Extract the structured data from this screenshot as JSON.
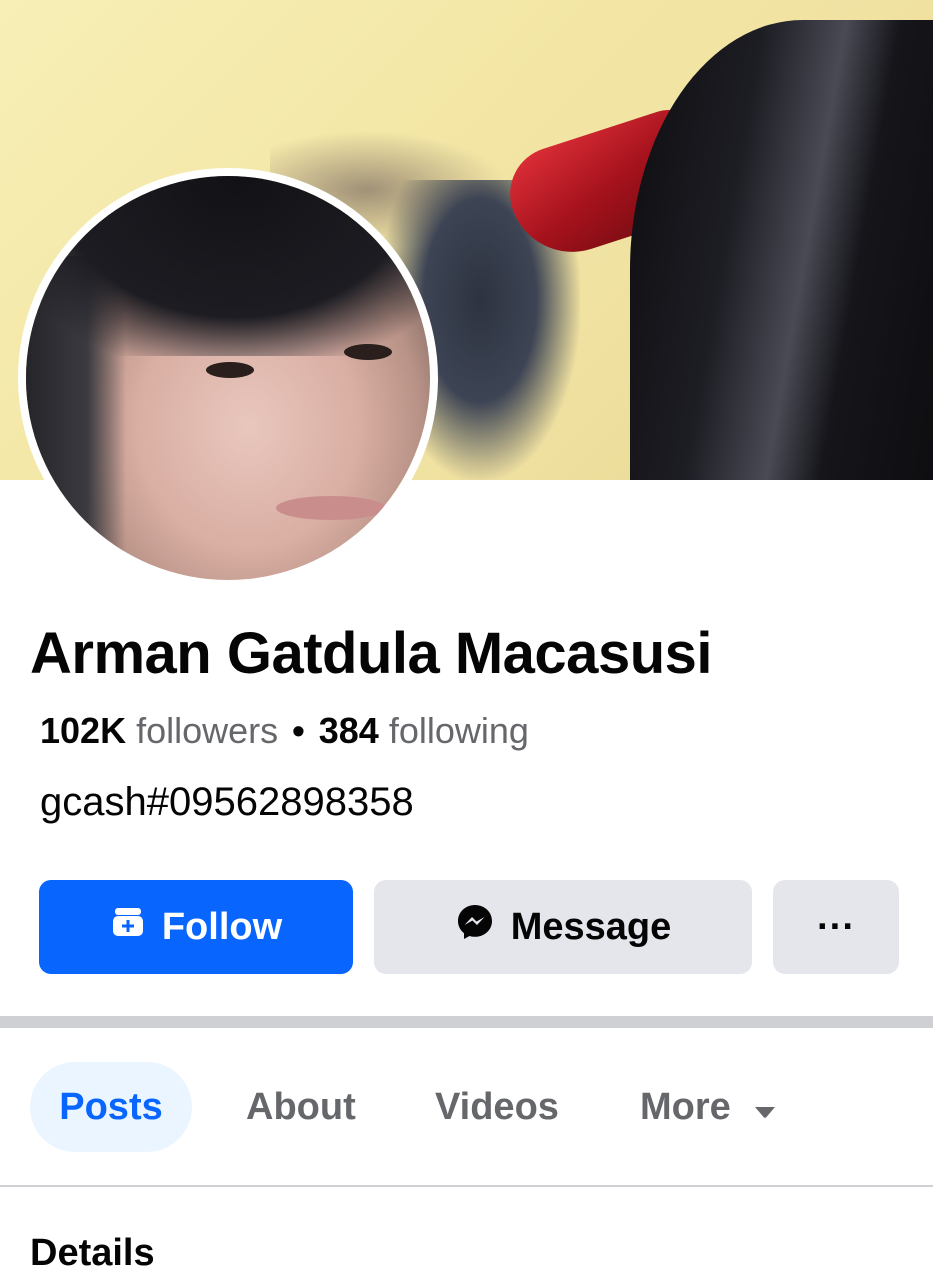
{
  "profile": {
    "name": "Arman Gatdula Macasusi",
    "followers_count": "102K",
    "followers_label": "followers",
    "separator": "•",
    "following_count": "384",
    "following_label": "following",
    "bio": "gcash#09562898358"
  },
  "actions": {
    "follow_label": "Follow",
    "follow_icon": "add-friend-icon",
    "message_label": "Message",
    "message_icon": "messenger-icon",
    "more_label": "···",
    "more_icon": "ellipsis-icon"
  },
  "tabs": [
    {
      "label": "Posts",
      "active": true
    },
    {
      "label": "About",
      "active": false
    },
    {
      "label": "Videos",
      "active": false
    },
    {
      "label": "More",
      "active": false
    }
  ],
  "tab_more_icon": "caret-down-icon",
  "sections": {
    "details_title": "Details"
  },
  "colors": {
    "accent": "#0866ff",
    "button_secondary": "#e4e6eb",
    "tab_active_bg": "#ebf5ff",
    "muted_text": "#65676b"
  }
}
